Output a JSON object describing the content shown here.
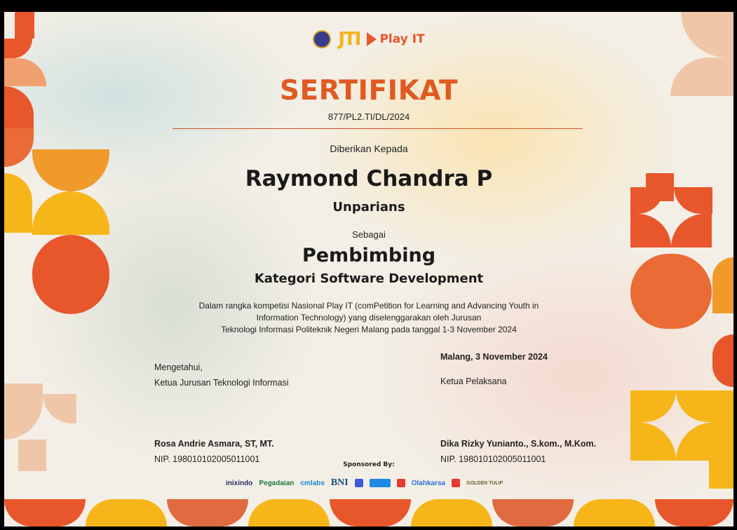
{
  "header": {
    "logos": [
      "university-emblem-icon",
      "jti-logo",
      "play-it-logo"
    ],
    "jti_text": "JTI",
    "play_it_text": "Play IT"
  },
  "certificate": {
    "title": "SERTIFIKAT",
    "number": "877/PL2.TI/DL/2024",
    "given_to_label": "Diberikan Kepada",
    "recipient_name": "Raymond Chandra P",
    "team_name": "Unparians",
    "as_label": "Sebagai",
    "role": "Pembimbing",
    "category": "Kategori Software Development",
    "description_lines": [
      "Dalam rangka kompetisi Nasional Play IT (comPetition for Learning and Advancing Youth in",
      "Information Technology) yang diselenggarakan oleh Jurusan",
      "Teknologi Informasi Politeknik Negeri Malang pada tanggal 1-3 November 2024"
    ]
  },
  "signatures": {
    "left": {
      "acknowledged": "Mengetahui,",
      "position": "Ketua Jurusan Teknologi Informasi",
      "name": "Rosa Andrie Asmara, ST, MT.",
      "nip": "NIP. 198010102005011001"
    },
    "right": {
      "place_date": "Malang, 3 November 2024",
      "position": "Ketua Pelaksana",
      "name": "Dika Rizky Yunianto., S.kom., M.Kom.",
      "nip": "NIP. 198010102005011001"
    }
  },
  "sponsors": {
    "label": "Sponsored By:",
    "items": [
      "inixindo",
      "Pegadaian",
      "cmlabs",
      "BNI",
      "Olahkarsa",
      "GOLDEN TULIP"
    ]
  },
  "colors": {
    "orange": "#e8562b",
    "yellow": "#f6b61a",
    "peach": "#efc7a8",
    "amber": "#f09a2c"
  }
}
